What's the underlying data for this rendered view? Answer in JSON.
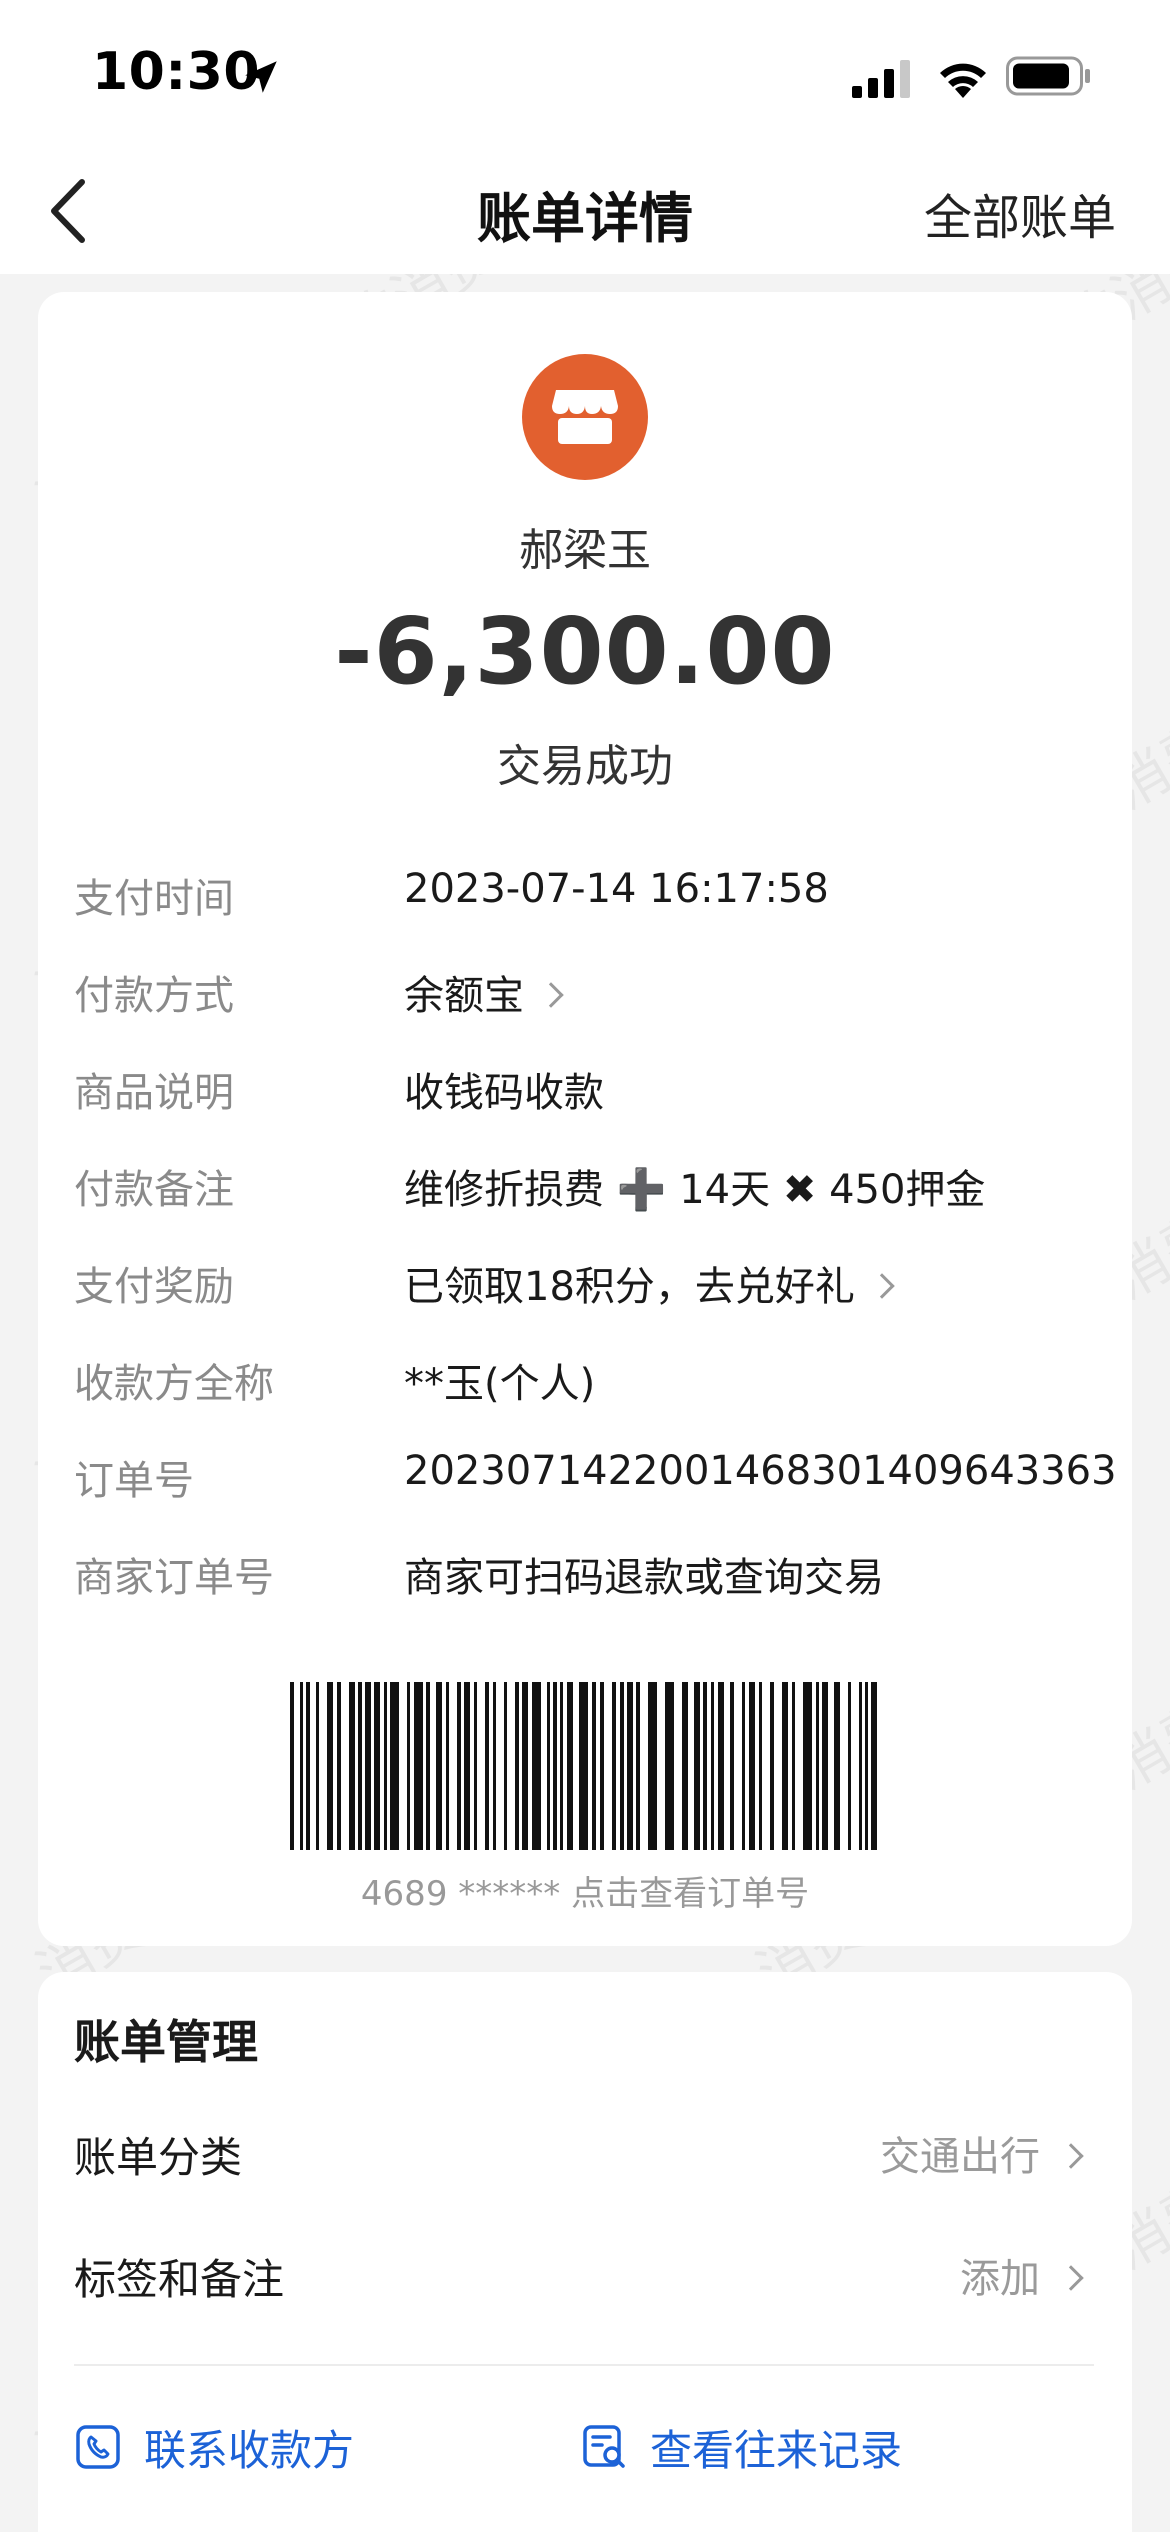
{
  "status_bar": {
    "time": "10:30"
  },
  "nav": {
    "title": "账单详情",
    "all_bills": "全部账单"
  },
  "merchant": {
    "name": "郝梁玉",
    "amount": "-6,300.00",
    "status": "交易成功",
    "avatar_color": "#e2602f"
  },
  "details": [
    {
      "label": "支付时间",
      "value": "2023-07-14 16:17:58",
      "arrow": false
    },
    {
      "label": "付款方式",
      "value": "余额宝",
      "arrow": true
    },
    {
      "label": "商品说明",
      "value": "收钱码收款",
      "arrow": false
    },
    {
      "label": "付款备注",
      "value": "维修折损费 ➕ 14天 ✖ 450押金",
      "arrow": false
    },
    {
      "label": "支付奖励",
      "value": "已领取18积分，去兑好礼",
      "arrow": true
    },
    {
      "label": "收款方全称",
      "value": "**玉(个人)",
      "arrow": false
    },
    {
      "label": "订单号",
      "value": "2023071422001468301409643363",
      "arrow": false
    },
    {
      "label": "商家订单号",
      "value": "商家可扫码退款或查询交易",
      "arrow": false
    }
  ],
  "barcode": {
    "caption": "4689 ****** 点击查看订单号"
  },
  "management": {
    "title": "账单管理",
    "rows": [
      {
        "label": "账单分类",
        "value": "交通出行"
      },
      {
        "label": "标签和备注",
        "value": "添加"
      }
    ],
    "actions": [
      {
        "label": "联系收款方",
        "icon": "phone-icon"
      },
      {
        "label": "查看往来记录",
        "icon": "records-icon"
      }
    ],
    "action_color": "#1c62d7"
  },
  "watermark_text": "消费保 您身边的消费服务管家"
}
